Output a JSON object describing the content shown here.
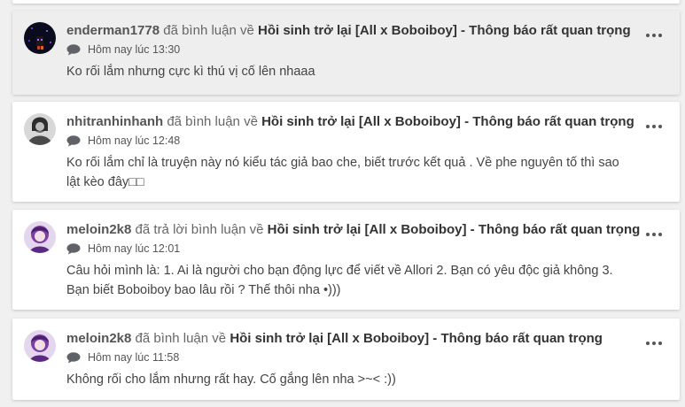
{
  "notifications": [
    {
      "username": "enderman1778",
      "action": "đã bình luận về",
      "story": "Hồi sinh trở lại [All x Boboiboy] - Thông báo rất quan trọng",
      "time": "Hôm nay lúc 13:30",
      "comment": "Ko rối lắm nhưng cực kì thú vị cố lên nhaaa",
      "highlighted": true
    },
    {
      "username": "nhitranhinhanh",
      "action": "đã bình luận về",
      "story": "Hồi sinh trở lại [All x Boboiboy] - Thông báo rất quan trọng",
      "time": "Hôm nay lúc 12:48",
      "comment": "Ko rối lắm chỉ là truyện này nó kiểu tác giả bao che, biết trước kết quả . Về phe nguyên tố thì sao lật kèo đây□□",
      "highlighted": false
    },
    {
      "username": "meloin2k8",
      "action": "đã trả lời bình luận về",
      "story": "Hồi sinh trở lại [All x Boboiboy] - Thông báo rất quan trọng",
      "time": "Hôm nay lúc 12:01",
      "comment": "Câu hỏi mình là: 1. Ai là người cho bạn động lực để viết về Allori 2. Bạn có yêu độc giả không 3. Bạn biết Boboiboy bao lâu rồi ? Thế thôi nha •)))",
      "highlighted": false
    },
    {
      "username": "meloin2k8",
      "action": "đã bình luận về",
      "story": "Hồi sinh trở lại [All x Boboiboy] - Thông báo rất quan trọng",
      "time": "Hôm nay lúc 11:58",
      "comment": "Không rối cho lắm nhưng rất hay. Cố gắng lên nha >~< :))",
      "highlighted": false
    }
  ],
  "icons": {
    "comment": "speech-bubble-icon",
    "more": "more-options-icon"
  },
  "colors": {
    "page_bg": "#f0f0f0",
    "card_bg": "#ffffff",
    "highlight_bg": "#eeeeee",
    "text": "#444444"
  }
}
